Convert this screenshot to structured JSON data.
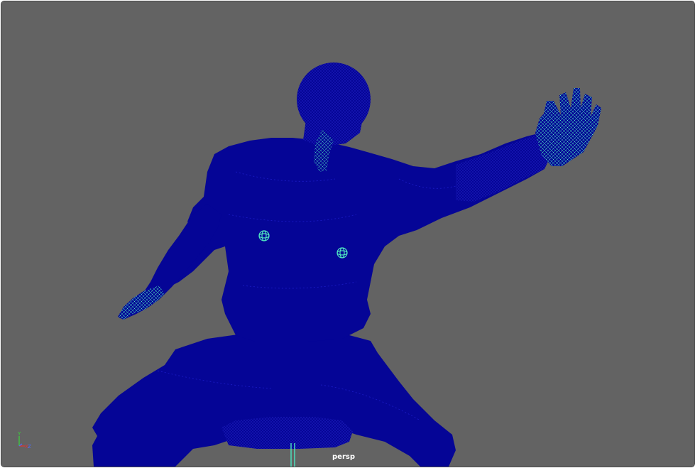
{
  "viewport": {
    "camera_label": "persp",
    "background_color": "#636363",
    "mesh_color": "#050596",
    "wire_color": "#4fe6c0",
    "subject": "character-wireframe-mesh"
  },
  "axis_gizmo": {
    "y_label": "Y",
    "x_label": "X",
    "z_label": "Z",
    "x_color": "#e83030",
    "y_color": "#3ad63a",
    "z_color": "#4a6cff"
  }
}
